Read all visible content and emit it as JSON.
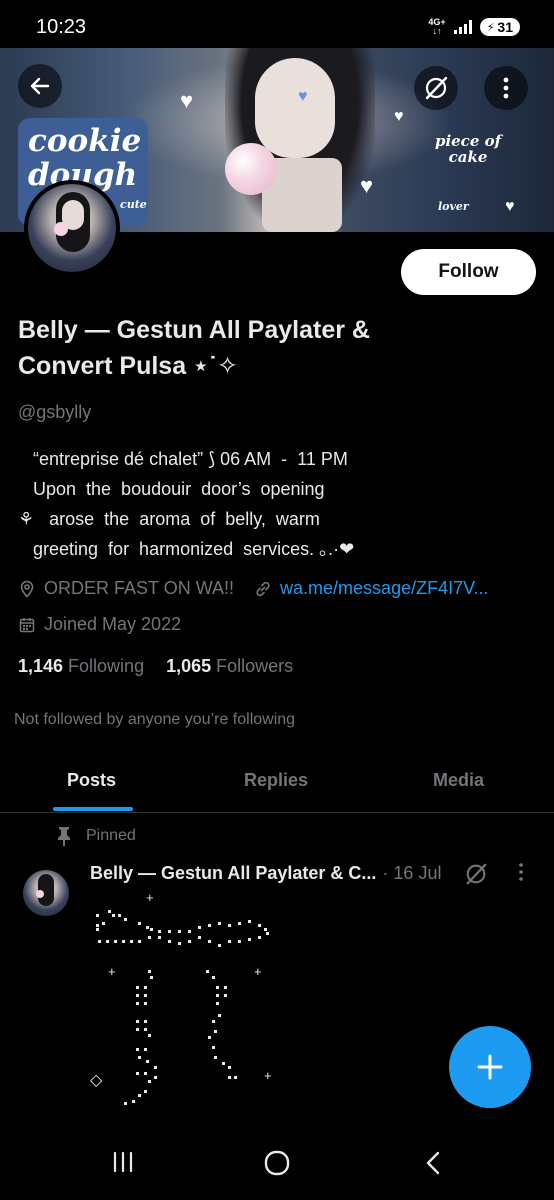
{
  "status_bar": {
    "time": "10:23",
    "network": "4G+",
    "battery": "31"
  },
  "banner": {
    "sticker_main": "cookie dough",
    "sticker_piece": "piece of cake",
    "sticker_lover": "lover",
    "sticker_cute": "cute"
  },
  "profile": {
    "follow_label": "Follow",
    "name": "Belly — Gestun All Paylater & Convert Pulsa ⋆˙✧",
    "handle": "@gsbylly",
    "bio_lines": [
      "   “entreprise dé chalet” ⟆ 06 AM  -  11 PM",
      "   Upon  the  boudouir  door’s  opening",
      "⚘   arose  the  aroma  of  belly,  warm",
      "   greeting  for  harmonized  services. ｡.·❤"
    ],
    "location": "ORDER FAST ON WA!!",
    "link": "wa.me/message/ZF4I7V...",
    "joined": "Joined May 2022",
    "following_count": "1,146",
    "following_label": "Following",
    "followers_count": "1,065",
    "followers_label": "Followers",
    "not_followed": "Not followed by anyone you’re following"
  },
  "tabs": {
    "posts": "Posts",
    "replies": "Replies",
    "media": "Media",
    "active": "Posts"
  },
  "post": {
    "pinned_label": "Pinned",
    "author": "Belly — Gestun All Paylater & C...",
    "date": "· 16 Jul"
  },
  "colors": {
    "accent": "#1d9bf0",
    "background": "#000000",
    "muted": "#71767b",
    "text": "#e7e9ea"
  },
  "icons": {
    "back": "arrow-left-icon",
    "grok": "grok-icon",
    "more": "more-vertical-icon",
    "location": "location-pin-icon",
    "link": "link-icon",
    "calendar": "calendar-icon",
    "pin": "pin-icon",
    "compose": "plus-icon"
  }
}
